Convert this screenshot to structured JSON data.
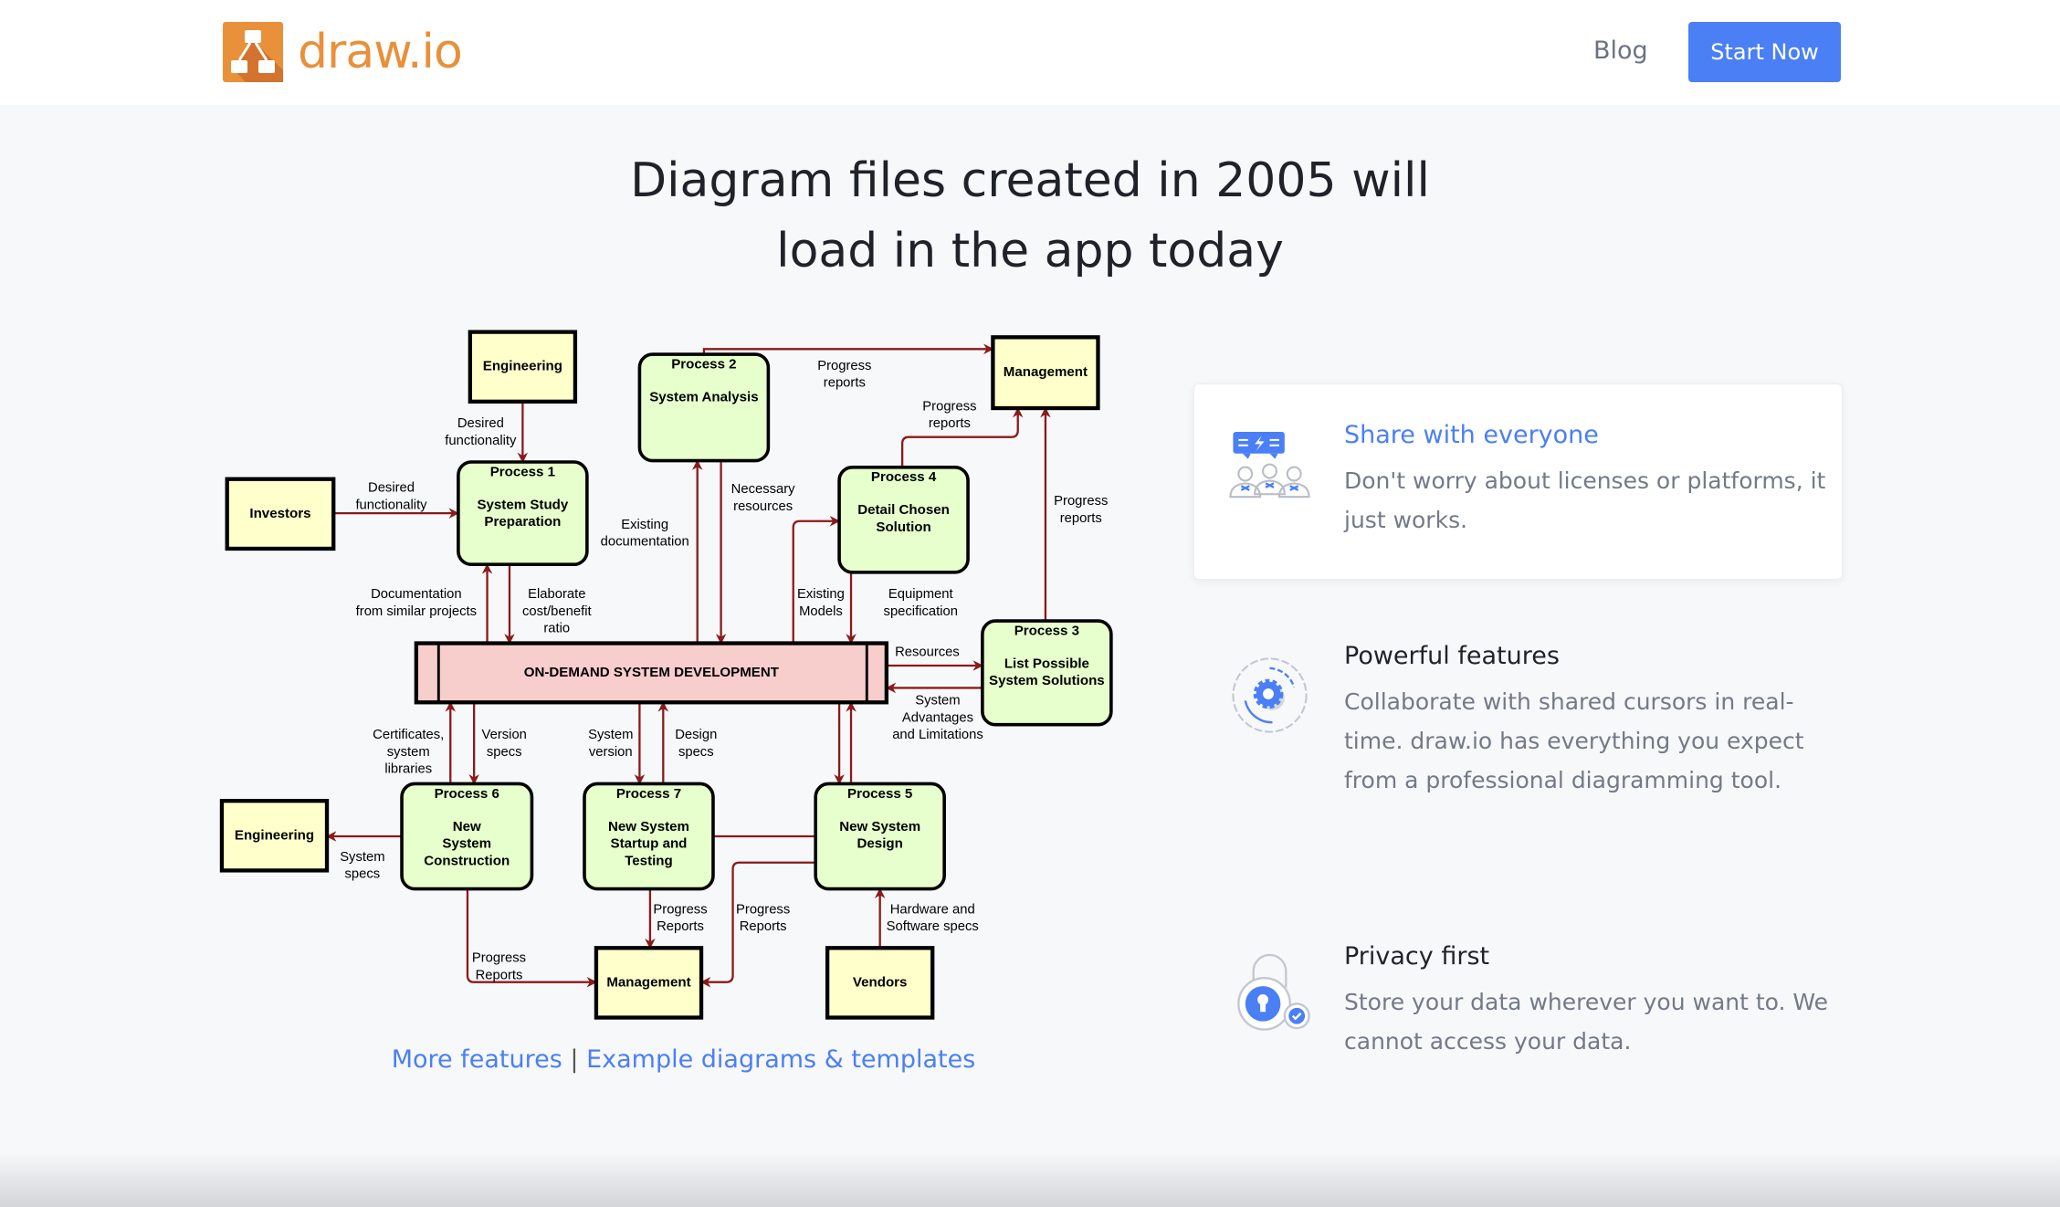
{
  "header": {
    "logo_text": "draw.io",
    "nav_blog": "Blog",
    "start_button": "Start Now"
  },
  "hero": {
    "line1": "Diagram files created in 2005 will",
    "line2": "load in the app today"
  },
  "diagram": {
    "nodes": {
      "eng_top": {
        "title": "",
        "lines": [
          "Engineering"
        ]
      },
      "p2": {
        "title": "Process 2",
        "lines": [
          "System Analysis"
        ]
      },
      "mgmt_top": {
        "title": "",
        "lines": [
          "Management"
        ]
      },
      "investors": {
        "title": "",
        "lines": [
          "Investors"
        ]
      },
      "p1": {
        "title": "Process 1",
        "lines": [
          "System Study",
          "Preparation"
        ]
      },
      "p4": {
        "title": "Process 4",
        "lines": [
          "Detail Chosen",
          "Solution"
        ]
      },
      "p3": {
        "title": "Process 3",
        "lines": [
          "List Possible",
          "System Solutions"
        ]
      },
      "bar": {
        "title": "",
        "lines": [
          "ON-DEMAND SYSTEM DEVELOPMENT"
        ]
      },
      "eng_bottom": {
        "title": "",
        "lines": [
          "Engineering"
        ]
      },
      "p6": {
        "title": "Process 6",
        "lines": [
          "New",
          "System",
          "Construction"
        ]
      },
      "p7": {
        "title": "Process 7",
        "lines": [
          "New System",
          "Startup and",
          "Testing"
        ]
      },
      "p5": {
        "title": "Process 5",
        "lines": [
          "New System",
          "Design"
        ]
      },
      "mgmt_bottom": {
        "title": "",
        "lines": [
          "Management"
        ]
      },
      "vendors": {
        "title": "",
        "lines": [
          "Vendors"
        ]
      }
    },
    "labels": {
      "eng_desired": [
        "Desired",
        "functionality"
      ],
      "inv_desired": [
        "Desired",
        "functionality"
      ],
      "prog_top": [
        "Progress",
        "reports"
      ],
      "prog_p4": [
        "Progress",
        "reports"
      ],
      "prog_p3": [
        "Progress",
        "reports"
      ],
      "existing_doc": [
        "Existing",
        "documentation"
      ],
      "necessary": [
        "Necessary",
        "resources"
      ],
      "documentation": [
        "Documentation",
        "from similar projects"
      ],
      "elaborate": [
        "Elaborate",
        "cost/benefit",
        "ratio"
      ],
      "existing_models": [
        "Existing",
        "Models"
      ],
      "equipment": [
        "Equipment",
        "specification"
      ],
      "resources": [
        "Resources"
      ],
      "sys_adv": [
        "System",
        "Advantages",
        "and Limitations"
      ],
      "certificates": [
        "Certificates,",
        "system",
        "libraries"
      ],
      "version_specs": [
        "Version",
        "specs"
      ],
      "system_version": [
        "System",
        "version"
      ],
      "design_specs": [
        "Design",
        "specs"
      ],
      "system_specs": [
        "System",
        "specs"
      ],
      "prog_p7": [
        "Progress",
        "Reports"
      ],
      "prog_p5": [
        "Progress",
        "Reports"
      ],
      "prog_p6": [
        "Progress",
        "Reports"
      ],
      "hardware": [
        "Hardware and",
        "Software specs"
      ]
    },
    "colors": {
      "external": "#ffffcc",
      "process": "#e6ffcc",
      "bar": "#f8cecc",
      "arrow": "#8b1a1a"
    }
  },
  "links": {
    "more_features": "More features",
    "separator": "|",
    "examples": "Example diagrams & templates"
  },
  "features": [
    {
      "title": "Share with everyone",
      "body": "Don't worry about licenses or platforms, it just works.",
      "icon": "share-people-icon"
    },
    {
      "title": "Powerful features",
      "body": "Collaborate with shared cursors in real-time. draw.io has everything you expect from a professional diagramming tool.",
      "icon": "gear-icon"
    },
    {
      "title": "Privacy first",
      "body": "Store your data wherever you want to. We cannot access your data.",
      "icon": "lock-icon"
    }
  ],
  "colors": {
    "accent": "#4a7ff5",
    "logo": "#e8903a"
  }
}
